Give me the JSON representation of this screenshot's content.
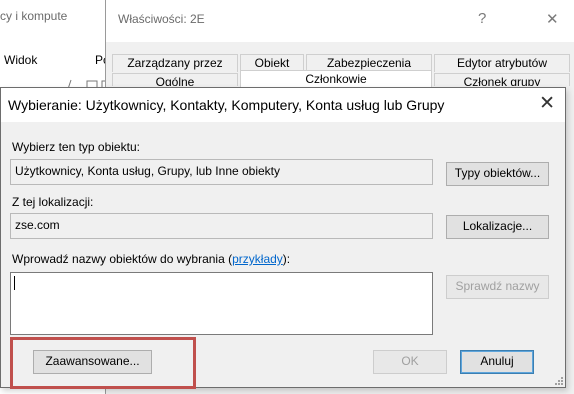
{
  "background_window": {
    "title_fragment": "cy i kompute",
    "menu": [
      "Widok",
      "Pc"
    ]
  },
  "properties_window": {
    "title": "Właściwości: 2E",
    "help": "?",
    "close": "✕",
    "tabs_row1": [
      "Zarządzany przez",
      "Obiekt",
      "Zabezpieczenia",
      "Edytor atrybutów"
    ],
    "tabs_row2": [
      "Ogólne",
      "Członkowie",
      "Członek grupy"
    ],
    "active_tab": "Członkowie"
  },
  "dialog": {
    "title": "Wybieranie: Użytkownicy, Kontakty, Komputery, Konta usług lub Grupy",
    "close": "✕",
    "object_type": {
      "label": "Wybierz ten typ obiektu:",
      "value": "Użytkownicy, Konta usług, Grupy, lub Inne obiekty",
      "button": "Typy obiektów..."
    },
    "location": {
      "label": "Z tej lokalizacji:",
      "value": "zse.com",
      "button": "Lokalizacje..."
    },
    "names": {
      "label_prefix": "Wprowadź nazwy obiektów do wybrania (",
      "link": "przykłady",
      "label_suffix": "):",
      "value": "",
      "check_button": "Sprawdź nazwy"
    },
    "advanced_button": "Zaawansowane...",
    "ok_button": "OK",
    "cancel_button": "Anuluj"
  },
  "colors": {
    "highlight_box": "#c0504d",
    "link": "#0066cc",
    "dialog_bg": "#f0f0f0"
  }
}
